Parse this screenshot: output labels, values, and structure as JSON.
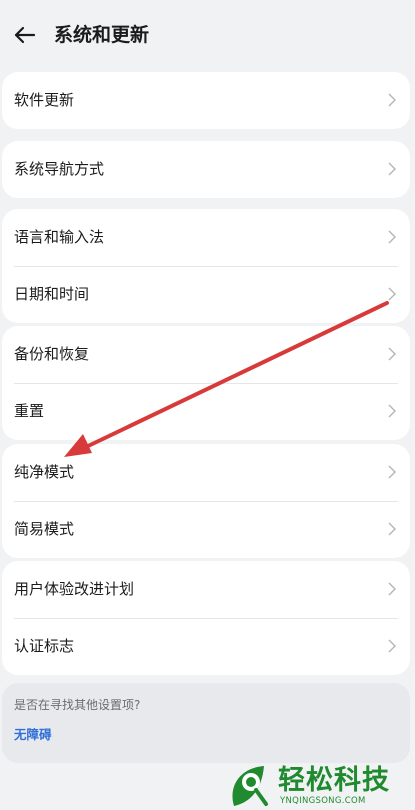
{
  "header": {
    "title": "系统和更新",
    "back_icon": "arrow-left-icon"
  },
  "groups": [
    {
      "items": [
        {
          "label": "软件更新"
        }
      ]
    },
    {
      "items": [
        {
          "label": "系统导航方式"
        }
      ]
    },
    {
      "items": [
        {
          "label": "语言和输入法"
        },
        {
          "label": "日期和时间"
        }
      ]
    },
    {
      "items": [
        {
          "label": "备份和恢复"
        },
        {
          "label": "重置"
        }
      ]
    },
    {
      "items": [
        {
          "label": "纯净模式"
        },
        {
          "label": "简易模式"
        }
      ]
    },
    {
      "items": [
        {
          "label": "用户体验改进计划"
        },
        {
          "label": "认证标志"
        }
      ]
    }
  ],
  "search_card": {
    "question": "是否在寻找其他设置项?",
    "link": "无障碍"
  },
  "annotation": {
    "color": "#d83a3a",
    "points_to": "纯净模式"
  },
  "watermark": {
    "title": "轻松科技",
    "subtitle": "YNQINGSONG.COM",
    "color": "#1f8a2e"
  },
  "colors": {
    "background": "#f1f2f4",
    "card": "#ffffff",
    "link": "#2f6fd8"
  }
}
